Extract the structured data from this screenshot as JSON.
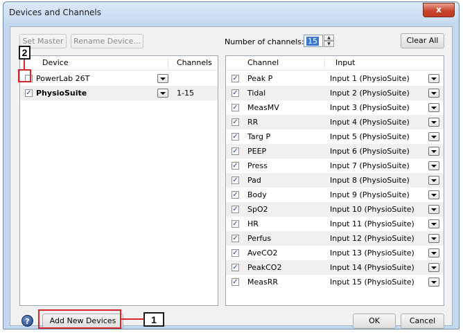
{
  "window": {
    "title": "Devices and Channels",
    "close_label": "x"
  },
  "toolbar": {
    "set_master": "Set Master",
    "rename_device": "Rename Device...",
    "num_channels_label": "Number of channels:",
    "num_channels_value": "15",
    "clear_all": "Clear All"
  },
  "devices": {
    "col_device": "Device",
    "col_channels": "Channels",
    "rows": [
      {
        "name": "PowerLab 26T",
        "checked": false,
        "channels": "",
        "bold": false
      },
      {
        "name": "PhysioSuite",
        "checked": true,
        "channels": "1-15",
        "bold": true
      }
    ]
  },
  "channels": {
    "col_channel": "Channel",
    "col_input": "Input",
    "rows": [
      {
        "name": "Peak P",
        "input": "Input 1 (PhysioSuite)"
      },
      {
        "name": "Tidal",
        "input": "Input 2 (PhysioSuite)"
      },
      {
        "name": "MeasMV",
        "input": "Input 3 (PhysioSuite)"
      },
      {
        "name": "RR",
        "input": "Input 4 (PhysioSuite)"
      },
      {
        "name": "Targ P",
        "input": "Input 5 (PhysioSuite)"
      },
      {
        "name": "PEEP",
        "input": "Input 6 (PhysioSuite)"
      },
      {
        "name": "Press",
        "input": "Input 7 (PhysioSuite)"
      },
      {
        "name": "Pad",
        "input": "Input 8 (PhysioSuite)"
      },
      {
        "name": "Body",
        "input": "Input 9 (PhysioSuite)"
      },
      {
        "name": "SpO2",
        "input": "Input 10 (PhysioSuite)"
      },
      {
        "name": "HR",
        "input": "Input 11 (PhysioSuite)"
      },
      {
        "name": "Perfus",
        "input": "Input 12 (PhysioSuite)"
      },
      {
        "name": "AveCO2",
        "input": "Input 13 (PhysioSuite)"
      },
      {
        "name": "PeakCO2",
        "input": "Input 14 (PhysioSuite)"
      },
      {
        "name": "MeasRR",
        "input": "Input 15 (PhysioSuite)"
      }
    ]
  },
  "footer": {
    "help_label": "?",
    "add_new_devices": "Add New Devices",
    "ok": "OK",
    "cancel": "Cancel"
  },
  "callouts": {
    "one": "1",
    "two": "2"
  },
  "colors": {
    "callout_red": "#d6262b",
    "checkmark": "#2b4b8a"
  },
  "icons": {
    "close": "close-icon",
    "help": "help-icon",
    "dropdown": "chevron-down-icon",
    "spinner": "spinner-arrows-icon"
  }
}
